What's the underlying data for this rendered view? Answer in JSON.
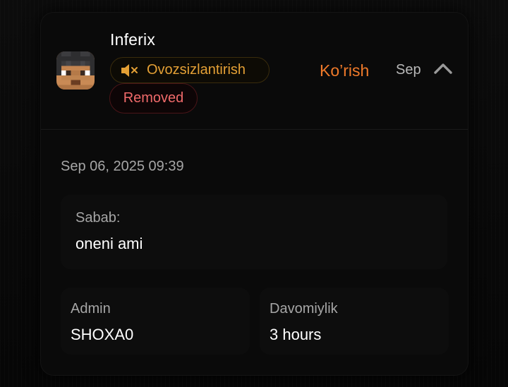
{
  "entry": {
    "username": "Inferix",
    "mute_badge": {
      "label": "Ovozsizlantirish",
      "icon": "speaker-muted-icon",
      "color": "#e4a035"
    },
    "status_badge": {
      "label": "Removed",
      "color": "#f06a6a"
    },
    "view_link": "Ko’rish",
    "date_short": "Sep",
    "collapse_icon": "chevron-up-icon",
    "timestamp": "Sep 06, 2025 09:39",
    "reason": {
      "label": "Sabab:",
      "value": "oneni ami"
    },
    "admin": {
      "label": "Admin",
      "value": "SHOXA0"
    },
    "duration": {
      "label": "Davomiylik",
      "value": "3 hours"
    }
  },
  "colors": {
    "accent": "#f07a2a",
    "background": "#0a0a0a"
  }
}
